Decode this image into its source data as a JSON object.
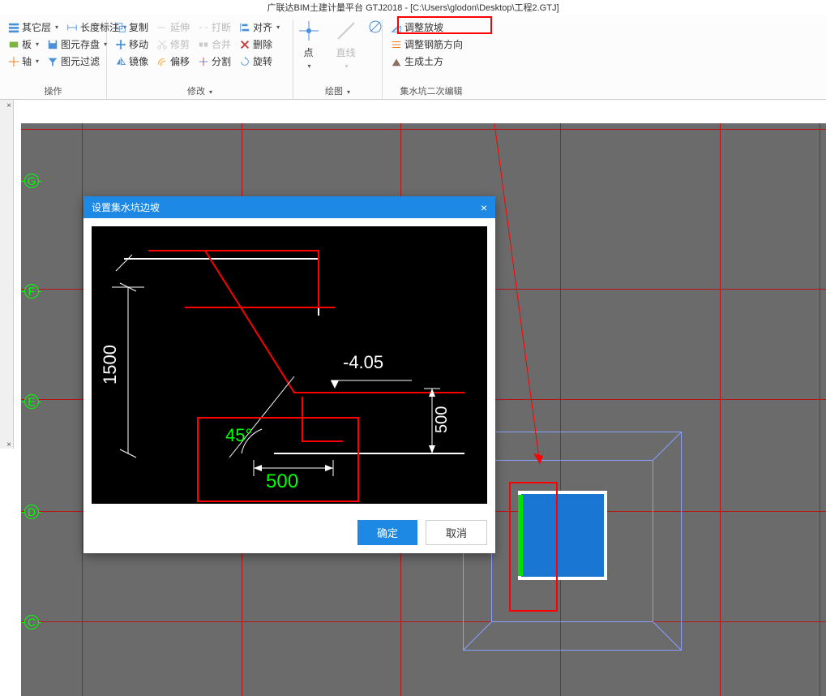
{
  "title": "广联达BIM土建计量平台 GTJ2018 - [C:\\Users\\glodon\\Desktop\\工程2.GTJ]",
  "ribbon": {
    "group1": {
      "r1a": "其它层",
      "r1b": "长度标注",
      "r2a": "板",
      "r2b": "图元存盘",
      "r3a": "轴",
      "r3b": "图元过滤",
      "label": "操作"
    },
    "group2": {
      "r1a": "复制",
      "r1b": "延伸",
      "r1c": "打断",
      "r1d": "对齐",
      "r2a": "移动",
      "r2b": "修剪",
      "r2c": "合并",
      "r2d": "删除",
      "r3a": "镜像",
      "r3b": "偏移",
      "r3c": "分割",
      "r3d": "旋转",
      "label": "修改"
    },
    "group3": {
      "a": "点",
      "b": "直线",
      "label": "绘图"
    },
    "group4": {
      "a": "调整放坡",
      "b": "调整钢筋方向",
      "c": "生成土方",
      "label": "集水坑二次编辑"
    }
  },
  "axis": {
    "g": "G",
    "f": "F",
    "e": "E",
    "d": "D",
    "c": "C"
  },
  "dialog": {
    "title": "设置集水坑边坡",
    "ok": "确定",
    "cancel": "取消",
    "dim1500": "1500",
    "dim500a": "500",
    "dim500b": "500",
    "elev": "-4.05",
    "angle": "45°"
  }
}
